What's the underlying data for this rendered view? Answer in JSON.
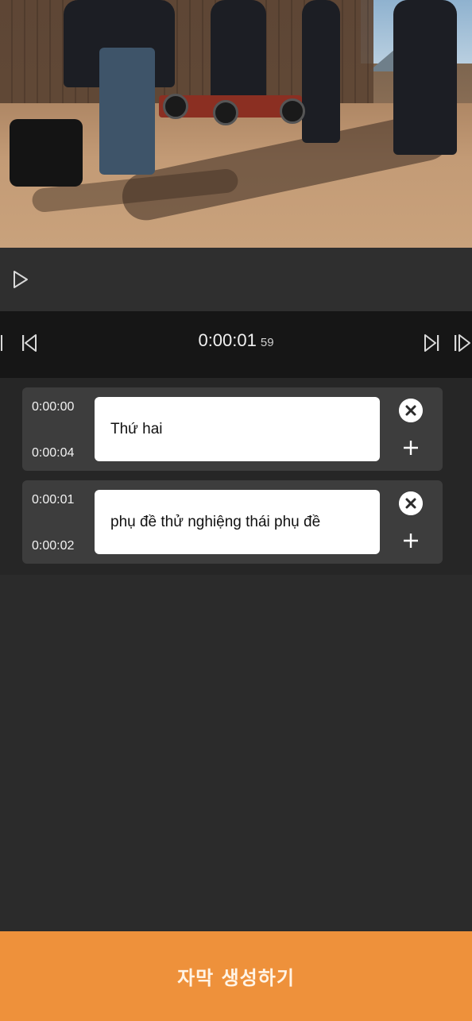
{
  "player": {
    "timecode": "0:00:01",
    "frames": "59",
    "icons": [
      "play-icon",
      "pause-bars-icon",
      "skip-to-start-icon",
      "skip-to-end-icon",
      "next-frame-icon"
    ]
  },
  "subtitles": [
    {
      "start": "0:00:00",
      "end": "0:00:04",
      "text": "Thứ hai"
    },
    {
      "start": "0:00:01",
      "end": "0:00:02",
      "text": "phụ đề thử nghiệng thái phụ đề"
    }
  ],
  "card_icons": [
    "close-circle-icon",
    "plus-icon"
  ],
  "action": {
    "label": "자막 생성하기"
  },
  "colors": {
    "accent": "#ee913b",
    "background": "#2b2b2b",
    "card": "#3d3d3d",
    "timebar": "#161616"
  }
}
